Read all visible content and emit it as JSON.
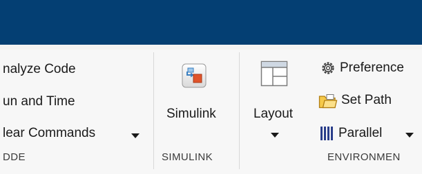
{
  "code_section": {
    "items": [
      {
        "label": "nalyze Code"
      },
      {
        "label": "un and Time"
      },
      {
        "label": "lear Commands"
      }
    ],
    "section_label": "DDE"
  },
  "simulink_section": {
    "button_label": "Simulink",
    "section_label": "SIMULINK"
  },
  "environment_section": {
    "layout_label": "Layout",
    "preferences_label": "Preference",
    "set_path_label": "Set Path",
    "parallel_label": "Parallel",
    "section_label": "ENVIRONMEN"
  },
  "colors": {
    "title_bar": "#043f73",
    "ribbon_bg": "#f7f7f7"
  }
}
